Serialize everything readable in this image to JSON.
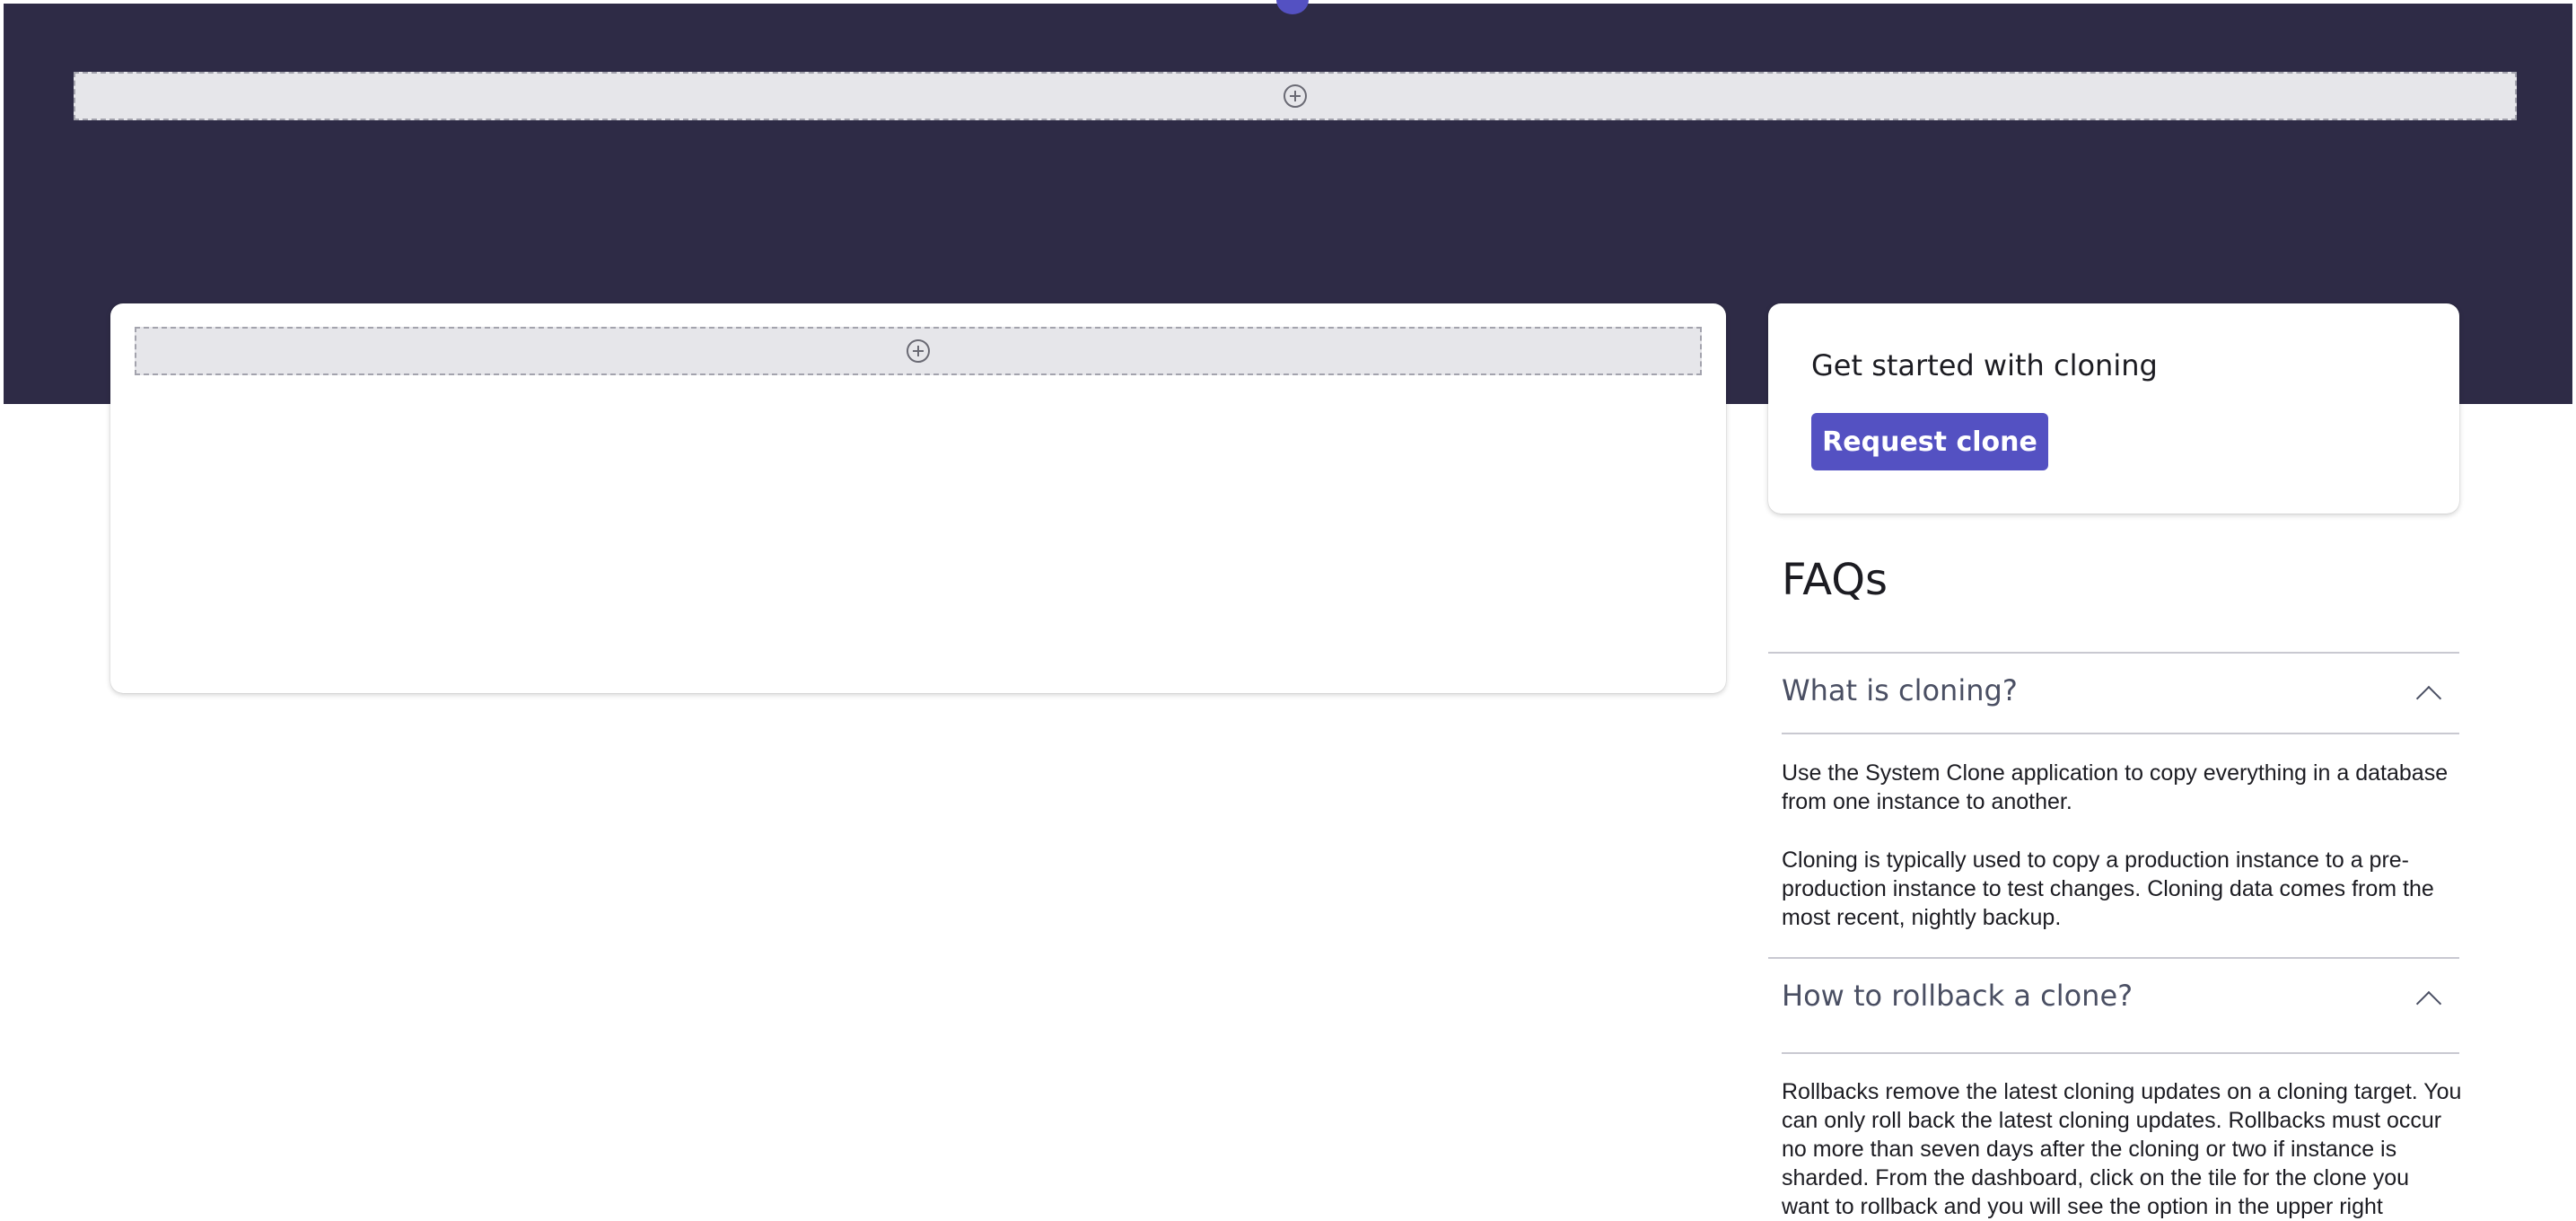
{
  "cta": {
    "title": "Get started with cloning",
    "button_label": "Request clone"
  },
  "faq": {
    "title": "FAQs",
    "items": [
      {
        "question": "What is cloning?",
        "answer_paragraphs": [
          "Use the System Clone application to copy everything in a database from one instance to another.",
          "Cloning is typically used to copy a production instance to a pre-production instance to test changes. Cloning data comes from the most recent, nightly backup."
        ]
      },
      {
        "question": "How to rollback a clone?",
        "answer_paragraphs": [
          "Rollbacks remove the latest cloning updates on a cloning target. You can only roll back the latest cloning updates. Rollbacks must occur no more than seven days after the cloning or two if instance is sharded.  From the dashboard, click on the tile for the clone you want to rollback and you will see the option in the upper right"
        ]
      }
    ]
  },
  "icons": {
    "add_zone": "plus-circle-icon",
    "expanded": "chevron-up-icon"
  },
  "colors": {
    "hero_background": "#2e2b46",
    "accent": "#5451c2",
    "dropzone": "#e6e6ea"
  }
}
